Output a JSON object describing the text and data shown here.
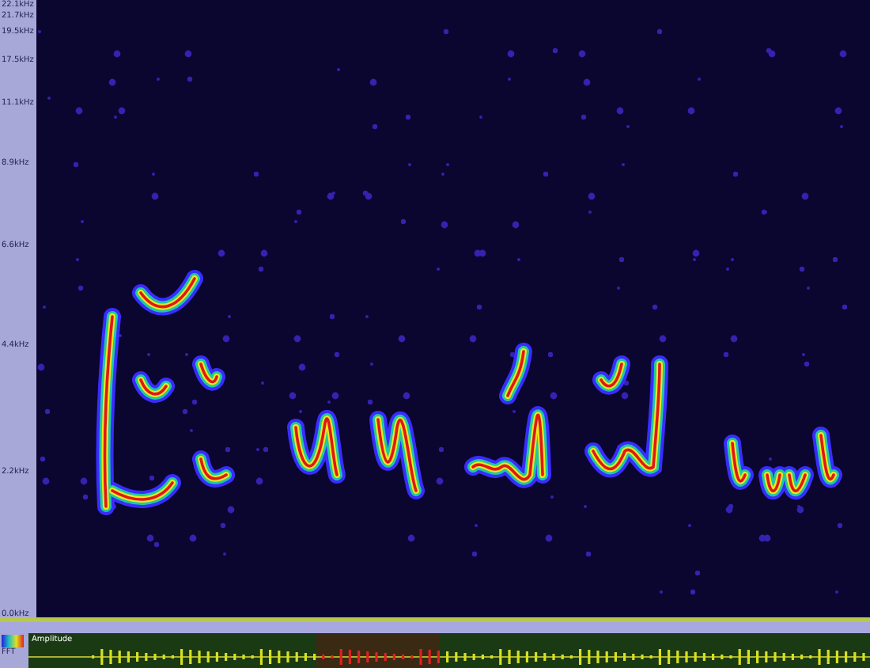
{
  "frequency_axis": {
    "labels": [
      "22.1kHz",
      "21.7kHz",
      "19.5kHz",
      "17.5kHz",
      "11.1kHz",
      "8.9kHz",
      "6.6kHz",
      "4.4kHz",
      "2.2kHz",
      "0.0kHz"
    ]
  },
  "overview": {
    "label": "Amplitude",
    "legend_text": "FFT"
  }
}
